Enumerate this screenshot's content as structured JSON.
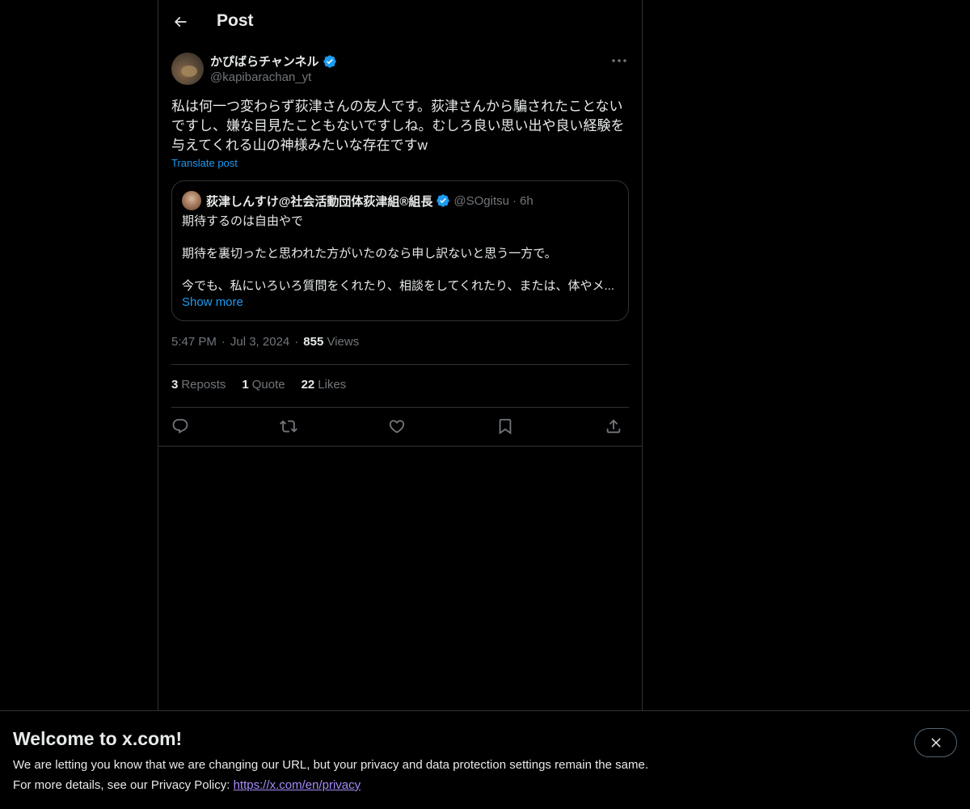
{
  "header": {
    "title": "Post"
  },
  "post": {
    "author_name": "かぴばらチャンネル",
    "author_handle": "@kapibarachan_yt",
    "text": "私は何一つ変わらず荻津さんの友人です。荻津さんから騙されたことないですし、嫌な目見たこともないですしね。むしろ良い思い出や良い経験を与えてくれる山の神様みたいな存在ですw",
    "translate_label": "Translate post",
    "time": "5:47 PM",
    "date": "Jul 3, 2024",
    "views_count": "855",
    "views_label": "Views"
  },
  "quote": {
    "author_name": "荻津しんすけ@社会活動団体荻津組®組長",
    "author_handle": "@SOgitsu",
    "time": "6h",
    "line1": "期待するのは自由やで",
    "line2": "期待を裏切ったと思われた方がいたのなら申し訳ないと思う一方で。",
    "line3": "今でも、私にいろいろ質問をくれたり、相談をしてくれたり、または、体やメ...",
    "show_more": "Show more"
  },
  "stats": {
    "reposts_count": "3",
    "reposts_label": "Reposts",
    "quotes_count": "1",
    "quotes_label": "Quote",
    "likes_count": "22",
    "likes_label": "Likes"
  },
  "banner": {
    "title": "Welcome to x.com!",
    "line1": "We are letting you know that we are changing our URL, but your privacy and data protection settings remain the same.",
    "line2_prefix": "For more details, see our Privacy Policy: ",
    "link": "https://x.com/en/privacy"
  },
  "icons": {
    "back": "arrow-left-icon",
    "more": "more-horizontal-icon",
    "verified": "verified-badge-icon",
    "reply": "reply-icon",
    "repost": "repost-icon",
    "like": "heart-icon",
    "bookmark": "bookmark-icon",
    "share": "share-icon",
    "close": "close-icon"
  },
  "colors": {
    "accent": "#1d9bf0",
    "background": "#000000",
    "muted": "#71767b",
    "link": "#a78bfa"
  }
}
